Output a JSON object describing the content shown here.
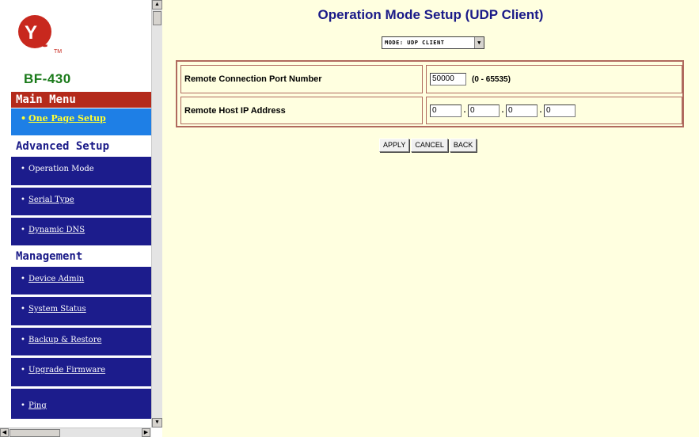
{
  "sidebar": {
    "model": "BF-430",
    "main_menu_label": "Main Menu",
    "one_page_setup": "One Page Setup",
    "advanced_setup_label": "Advanced Setup",
    "advanced_items": [
      "Operation Mode",
      "Serial Type",
      "Dynamic DNS"
    ],
    "management_label": "Management",
    "management_items": [
      "Device Admin",
      "System Status",
      "Backup & Restore",
      "Upgrade Firmware",
      "Ping"
    ],
    "bullet": "•"
  },
  "main": {
    "title": "Operation Mode Setup (UDP Client)",
    "mode_select_value": "MODE: UDP CLIENT",
    "port_label": "Remote Connection Port Number",
    "port_value": "50000",
    "port_range": "(0 - 65535)",
    "host_label": "Remote Host IP Address",
    "ip_octets": [
      "0",
      "0",
      "0",
      "0"
    ],
    "ip_separator": ".",
    "buttons": {
      "apply": "APPLY",
      "cancel": "CANCEL",
      "back": "BACK"
    }
  },
  "colors": {
    "content_bg": "#ffffe0",
    "menu_blue": "#1c1c8c",
    "main_menu_red": "#b42a1b",
    "one_page_blue": "#1e7fe6",
    "model_green": "#1a7a1a",
    "title_blue": "#1a1a88",
    "table_border": "#b06a5e",
    "logo_red": "#c8281e"
  },
  "icons": {
    "logo": "yt-logo",
    "scroll_up": "triangle-up-icon",
    "scroll_down": "triangle-down-icon",
    "scroll_left": "triangle-left-icon",
    "scroll_right": "triangle-right-icon",
    "select_arrow": "chevron-down-icon"
  }
}
